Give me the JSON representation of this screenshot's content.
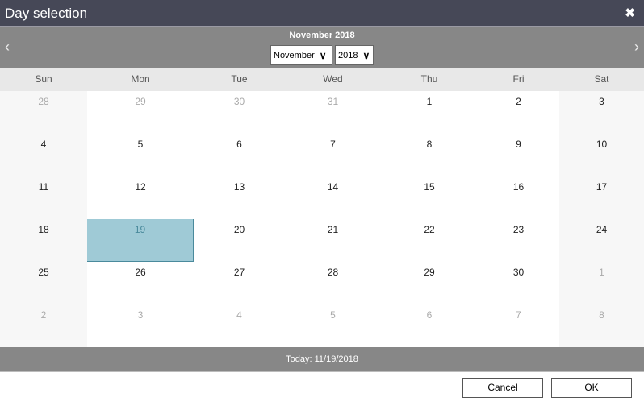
{
  "dialog": {
    "title": "Day selection",
    "close_icon": "close-icon"
  },
  "nav": {
    "month_title": "November 2018",
    "prev_icon": "chevron-left-icon",
    "next_icon": "chevron-right-icon",
    "month_select": "November",
    "year_select": "2018"
  },
  "calendar": {
    "weekdays": [
      "Sun",
      "Mon",
      "Tue",
      "Wed",
      "Thu",
      "Fri",
      "Sat"
    ],
    "weeks": [
      [
        "28",
        "29",
        "30",
        "31",
        "1",
        "2",
        "3"
      ],
      [
        "4",
        "5",
        "6",
        "7",
        "8",
        "9",
        "10"
      ],
      [
        "11",
        "12",
        "13",
        "14",
        "15",
        "16",
        "17"
      ],
      [
        "18",
        "19",
        "20",
        "21",
        "22",
        "23",
        "24"
      ],
      [
        "25",
        "26",
        "27",
        "28",
        "29",
        "30",
        "1"
      ],
      [
        "2",
        "3",
        "4",
        "5",
        "6",
        "7",
        "8"
      ]
    ],
    "selected_day": "19",
    "selected_color": "#9fcad6"
  },
  "footer": {
    "today": "Today: 11/19/2018"
  },
  "buttons": {
    "cancel": "Cancel",
    "ok": "OK"
  }
}
